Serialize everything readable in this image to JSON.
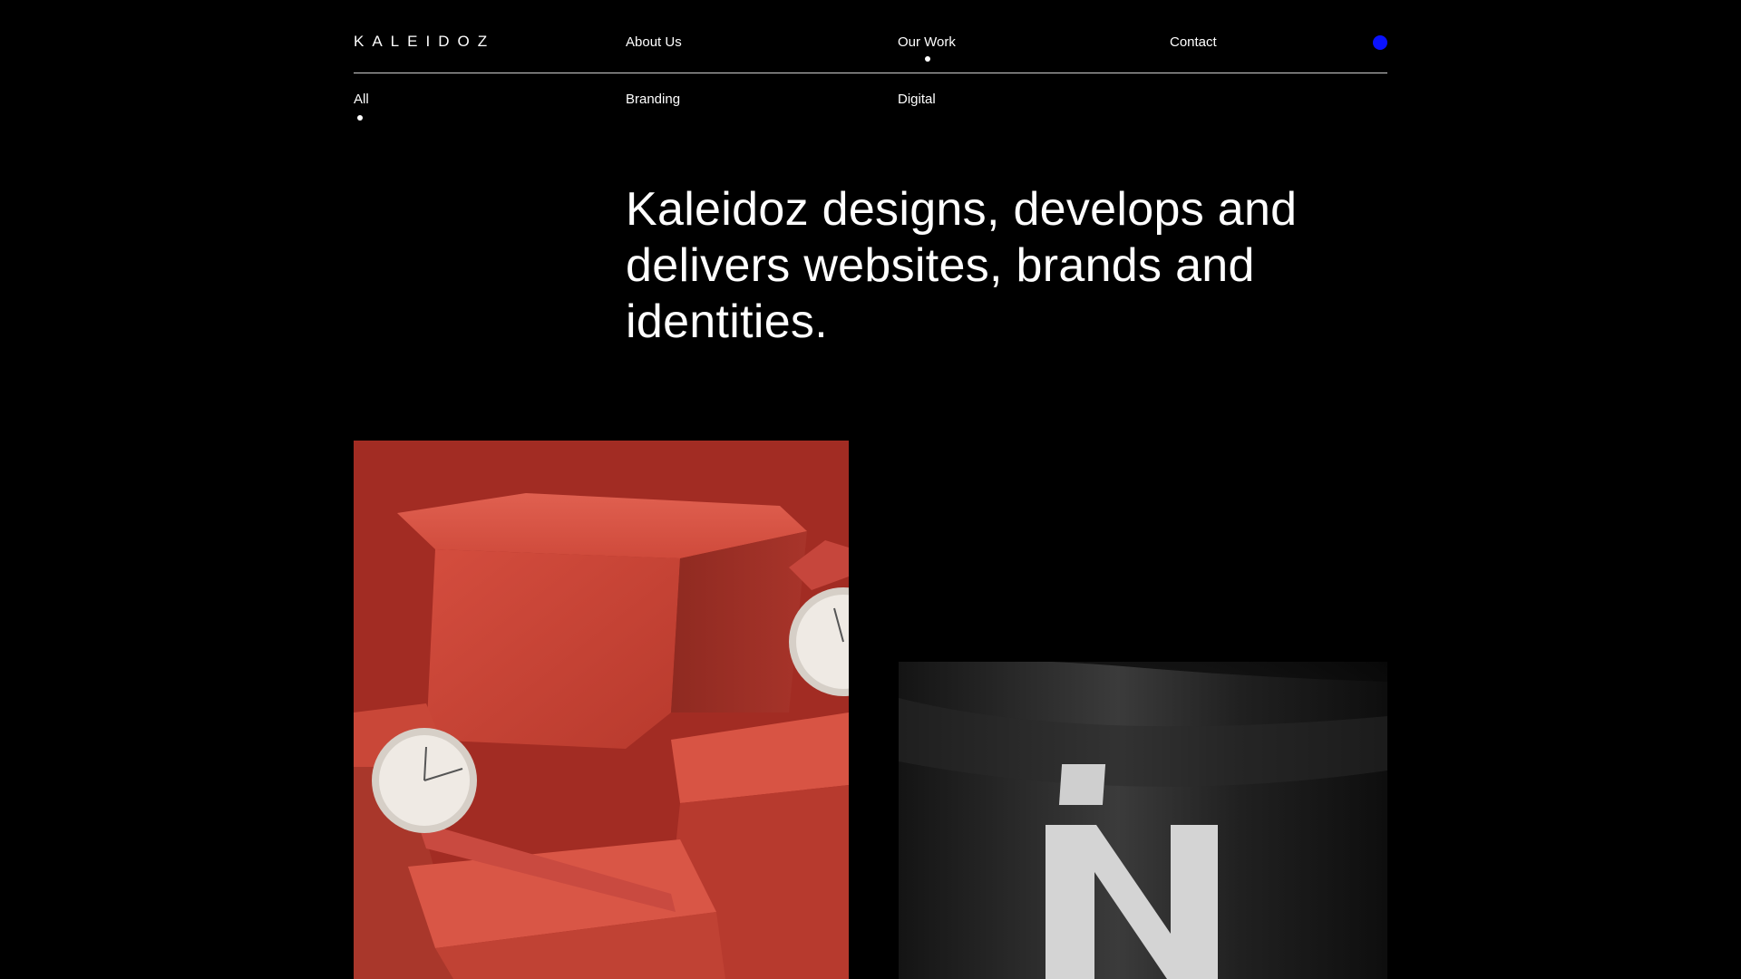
{
  "header": {
    "logo": "KALEIDOZ",
    "nav": {
      "about": "About Us",
      "work": "Our Work",
      "contact": "Contact"
    },
    "accent_color": "#0a12ff",
    "active_nav": "Our Work"
  },
  "filters": {
    "all": "All",
    "branding": "Branding",
    "digital": "Digital",
    "active": "All"
  },
  "hero": {
    "headline": "Kaleidoz designs, develops and delivers websites, brands and identities."
  },
  "projects": [
    {
      "image": "red-watch-photo",
      "dominant_color": "#c0392b"
    },
    {
      "image": "black-flag-photo",
      "dominant_color": "#1c1c1c"
    }
  ]
}
